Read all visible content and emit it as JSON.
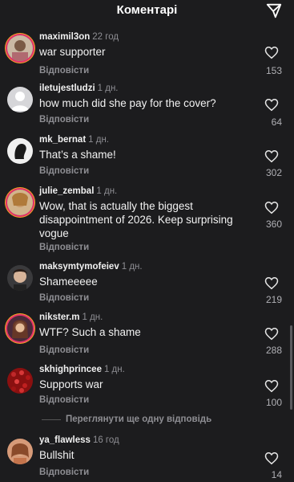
{
  "header": {
    "title": "Коментарі",
    "share_icon": "send-icon"
  },
  "reply_label": "Відповісти",
  "more_replies_label": "Переглянути ще одну відповідь",
  "comments": [
    {
      "username": "maximil3on",
      "time": "22 год",
      "text": "war supporter",
      "likes": "153"
    },
    {
      "username": "iletujestludzi",
      "time": "1 дн.",
      "text": "how much did she pay for the cover?",
      "likes": "64"
    },
    {
      "username": "mk_bernat",
      "time": "1 дн.",
      "text": "That’s a shame!",
      "likes": "302"
    },
    {
      "username": "julie_zembal",
      "time": "1 дн.",
      "text": "Wow, that is actually the biggest disappointment of 2026. Keep surprising vogue",
      "likes": "360"
    },
    {
      "username": "maksymtymofeiev",
      "time": "1 дн.",
      "text": "Shameeeee",
      "likes": "219"
    },
    {
      "username": "nikster.m",
      "time": "1 дн.",
      "text": "WTF? Such a shame",
      "likes": "288"
    },
    {
      "username": "skhighprincee",
      "time": "1 дн.",
      "text": "Supports war",
      "likes": "100"
    },
    {
      "username": "ya_flawless",
      "time": "16 год",
      "text": "Bullshit",
      "likes": "14"
    }
  ]
}
